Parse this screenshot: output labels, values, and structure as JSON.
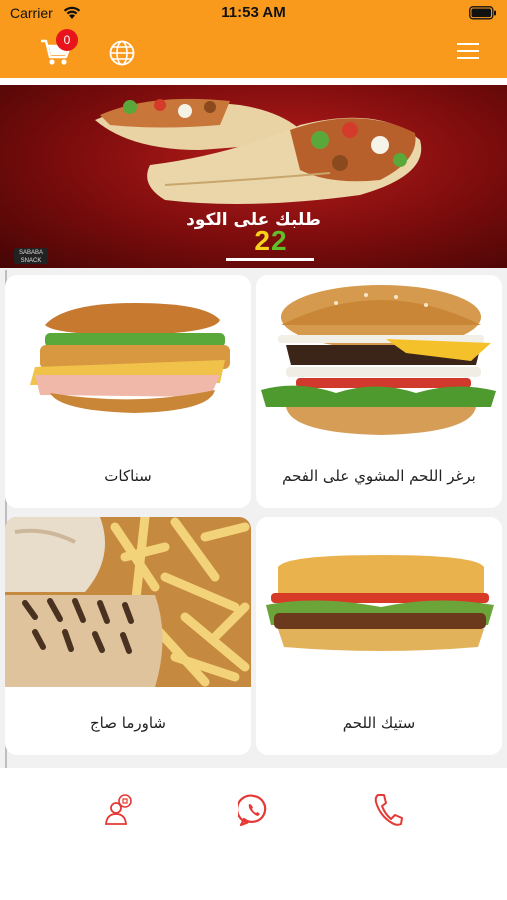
{
  "status_bar": {
    "carrier": "Carrier",
    "time": "11:53 AM"
  },
  "header": {
    "cart_count": "0",
    "accent_color": "#f99a1c",
    "badge_color": "#e8141c"
  },
  "banner": {
    "headline": "طلبك على الكود",
    "code_digit_1": "2",
    "code_digit_2": "2",
    "logo_text": "SABABA SNACK"
  },
  "categories": [
    {
      "title": "برغر اللحم المشوي على الفحم"
    },
    {
      "title": "سناكات"
    },
    {
      "title": "ستيك اللحم"
    },
    {
      "title": "شاورما صاج"
    }
  ],
  "footer": {
    "icons": [
      "contact-person-icon",
      "whatsapp-icon",
      "phone-icon"
    ],
    "icon_color": "#e53935"
  }
}
